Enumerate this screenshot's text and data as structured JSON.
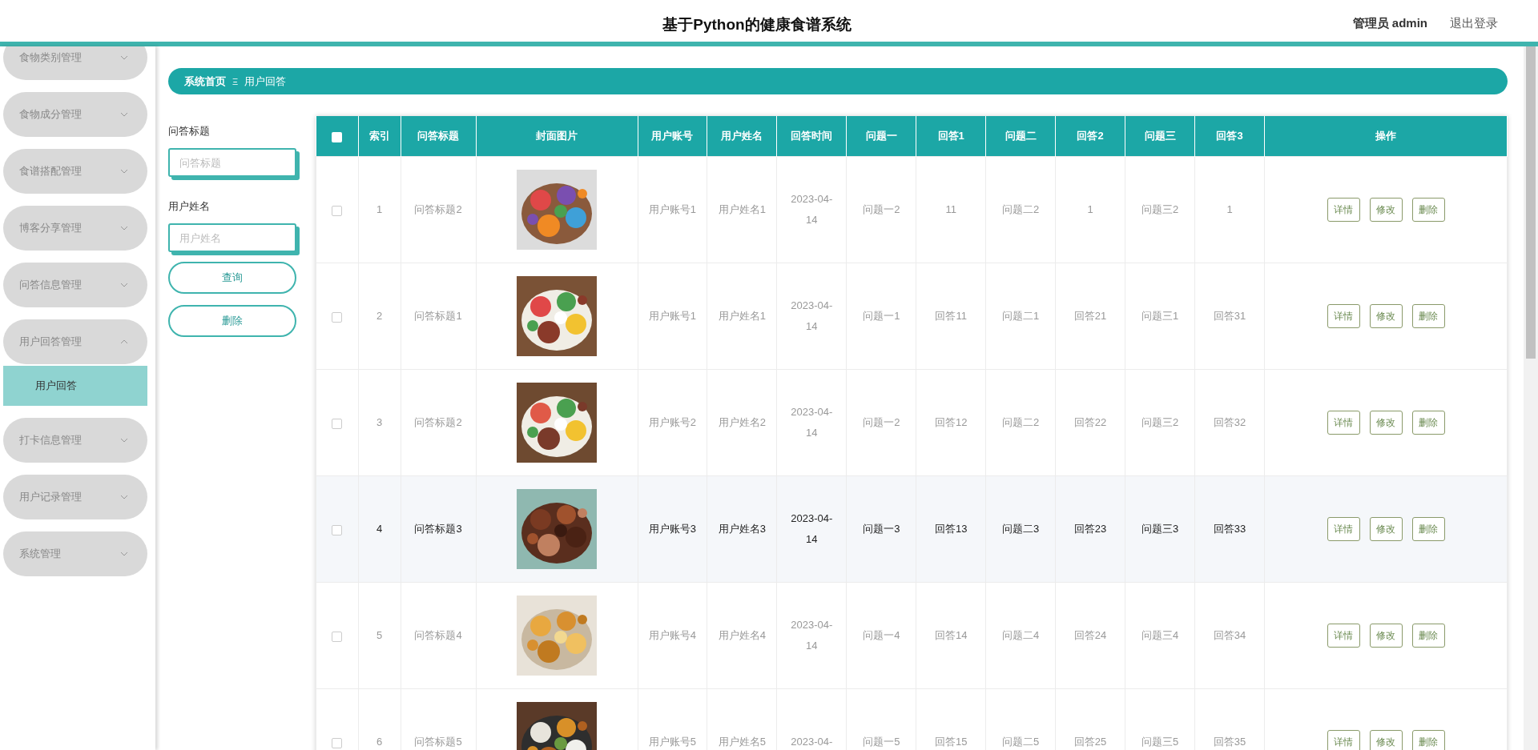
{
  "header": {
    "title": "基于Python的健康食谱系统",
    "user": "管理员 admin",
    "logout": "退出登录"
  },
  "sidebar": {
    "items": [
      {
        "label": "食物类别管理",
        "expanded": false
      },
      {
        "label": "食物成分管理",
        "expanded": false
      },
      {
        "label": "食谱搭配管理",
        "expanded": false
      },
      {
        "label": "博客分享管理",
        "expanded": false
      },
      {
        "label": "问答信息管理",
        "expanded": false
      },
      {
        "label": "用户回答管理",
        "expanded": true,
        "children": [
          {
            "label": "用户回答",
            "selected": true
          }
        ]
      },
      {
        "label": "打卡信息管理",
        "expanded": false
      },
      {
        "label": "用户记录管理",
        "expanded": false
      },
      {
        "label": "系统管理",
        "expanded": false
      }
    ]
  },
  "breadcrumb": {
    "home": "系统首页",
    "separator": "Ξ",
    "current": "用户回答"
  },
  "search": {
    "fields": [
      {
        "label": "问答标题",
        "placeholder": "问答标题"
      },
      {
        "label": "用户姓名",
        "placeholder": "用户姓名"
      }
    ],
    "buttons": [
      {
        "label": "查询",
        "kind": "query"
      },
      {
        "label": "删除",
        "kind": "delete"
      }
    ]
  },
  "table": {
    "columns": [
      {
        "kind": "check",
        "checked": false
      },
      {
        "kind": "text",
        "label": "索引"
      },
      {
        "kind": "text",
        "label": "问答标题"
      },
      {
        "label": "封面图片"
      },
      {
        "kind": "text",
        "label": "用户账号"
      },
      {
        "kind": "text",
        "label": "用户姓名"
      },
      {
        "kind": "text",
        "label": "回答时间"
      },
      {
        "kind": "text",
        "label": "问题一"
      },
      {
        "kind": "text",
        "label": "回答1"
      },
      {
        "kind": "text",
        "label": "问题二"
      },
      {
        "kind": "text",
        "label": "回答2"
      },
      {
        "kind": "text",
        "label": "问题三"
      },
      {
        "kind": "text",
        "label": "回答3"
      },
      {
        "kind": "actions",
        "label": "操作"
      }
    ],
    "rows": [
      {
        "highlighted": false,
        "cells": [
          {
            "checked": false
          },
          "1",
          "问答标题2",
          {
            "kind": "picture"
          },
          "用户账号1",
          "用户姓名1",
          "2023-04-14",
          "问题一2",
          "11",
          "问题二2",
          "1",
          "问题三2",
          "1",
          [
            "详情",
            "修改",
            "删除"
          ]
        ]
      },
      {
        "highlighted": false,
        "cells": [
          {
            "checked": false
          },
          "2",
          "问答标题1",
          {
            "kind": "picture"
          },
          "用户账号1",
          "用户姓名1",
          "2023-04-14",
          "问题一1",
          "回答11",
          "问题二1",
          "回答21",
          "问题三1",
          "回答31",
          [
            "详情",
            "修改",
            "删除"
          ]
        ]
      },
      {
        "highlighted": false,
        "cells": [
          {
            "checked": false
          },
          "3",
          "问答标题2",
          {
            "kind": "picture"
          },
          "用户账号2",
          "用户姓名2",
          "2023-04-14",
          "问题一2",
          "回答12",
          "问题二2",
          "回答22",
          "问题三2",
          "回答32",
          [
            "详情",
            "修改",
            "删除"
          ]
        ]
      },
      {
        "highlighted": true,
        "cells": [
          {
            "checked": false
          },
          "4",
          "问答标题3",
          {
            "kind": "picture"
          },
          "用户账号3",
          "用户姓名3",
          "2023-04-14",
          "问题一3",
          "回答13",
          "问题二3",
          "回答23",
          "问题三3",
          "回答33",
          [
            "详情",
            "修改",
            "删除"
          ]
        ]
      },
      {
        "highlighted": false,
        "cells": [
          {
            "checked": false
          },
          "5",
          "问答标题4",
          {
            "kind": "picture"
          },
          "用户账号4",
          "用户姓名4",
          "2023-04-14",
          "问题一4",
          "回答14",
          "问题二4",
          "回答24",
          "问题三4",
          "回答34",
          [
            "详情",
            "修改",
            "删除"
          ]
        ]
      },
      {
        "highlighted": false,
        "cells": [
          {
            "checked": false
          },
          "6",
          "问答标题5",
          {
            "kind": "picture"
          },
          "用户账号5",
          "用户姓名5",
          "2023-04-",
          "问题一5",
          "回答15",
          "问题二5",
          "回答25",
          "问题三5",
          "回答35",
          [
            "详情",
            "修改",
            "删除"
          ]
        ]
      }
    ]
  }
}
